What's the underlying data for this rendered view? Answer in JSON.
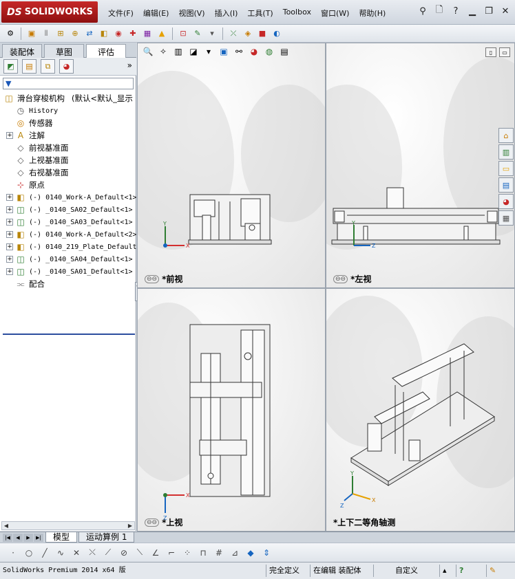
{
  "app": {
    "brand_mark": "DS",
    "brand_name": "SOLIDWORKS"
  },
  "menu": {
    "items": [
      "文件(F)",
      "编辑(E)",
      "视图(V)",
      "插入(I)",
      "工具(T)",
      "Toolbox",
      "窗口(W)",
      "帮助(H)"
    ],
    "help_icon": "?"
  },
  "left_panel": {
    "tabs": [
      "装配体",
      "草图",
      "评估"
    ],
    "active_tab": "评估",
    "filter_icon": "funnel-icon",
    "tree": {
      "root": {
        "label": "滑台穿梭机构",
        "config": "(默认<默认_显示"
      },
      "items": [
        {
          "label": "History",
          "icon": "history-icon",
          "expander": false,
          "mono": true
        },
        {
          "label": "传感器",
          "icon": "sensor-icon",
          "expander": false,
          "mono": false
        },
        {
          "label": "注解",
          "icon": "annotation-icon",
          "expander": true,
          "mono": false
        },
        {
          "label": "前视基准面",
          "icon": "plane-icon",
          "expander": false,
          "mono": false
        },
        {
          "label": "上视基准面",
          "icon": "plane-icon",
          "expander": false,
          "mono": false
        },
        {
          "label": "右视基准面",
          "icon": "plane-icon",
          "expander": false,
          "mono": false
        },
        {
          "label": "原点",
          "icon": "origin-icon",
          "expander": false,
          "mono": false
        },
        {
          "label": "(-) 0140_Work-A_Default<1>",
          "icon": "part-icon",
          "expander": true,
          "mono": true
        },
        {
          "label": "(-) _0140_SA02_Default<1>",
          "icon": "subassembly-icon",
          "expander": true,
          "mono": true
        },
        {
          "label": "(-) _0140_SA03_Default<1>",
          "icon": "subassembly-icon",
          "expander": true,
          "mono": true
        },
        {
          "label": "(-) 0140_Work-A_Default<2>",
          "icon": "part-icon",
          "expander": true,
          "mono": true
        },
        {
          "label": "(-) 0140_219_Plate_Default<",
          "icon": "part-icon",
          "expander": true,
          "mono": true
        },
        {
          "label": "(-) _0140_SA04_Default<1>",
          "icon": "subassembly-icon",
          "expander": true,
          "mono": true
        },
        {
          "label": "(-) _0140_SA01_Default<1>",
          "icon": "subassembly-icon",
          "expander": true,
          "mono": true
        },
        {
          "label": "配合",
          "icon": "mates-icon",
          "expander": false,
          "mono": false
        }
      ]
    }
  },
  "viewports": [
    {
      "id": "front",
      "label": "*前视"
    },
    {
      "id": "left",
      "label": "*左视"
    },
    {
      "id": "top",
      "label": "*上视"
    },
    {
      "id": "trimetric",
      "label": "*上下二等角轴测"
    }
  ],
  "axes": {
    "x": "X",
    "y": "Y",
    "z": "Z"
  },
  "bottom_tabs": [
    "模型",
    "运动算例 1"
  ],
  "active_bottom_tab": "模型",
  "status": {
    "product": "SolidWorks Premium 2014 x64 版",
    "definition": "完全定义",
    "editing": "在编辑 装配体",
    "units": "自定义"
  },
  "colors": {
    "brand_red": "#b71c1c",
    "accent_blue": "#2a4d9e",
    "axis_x": "#d32f2f",
    "axis_y": "#2e7d32",
    "axis_z": "#1565c0"
  }
}
